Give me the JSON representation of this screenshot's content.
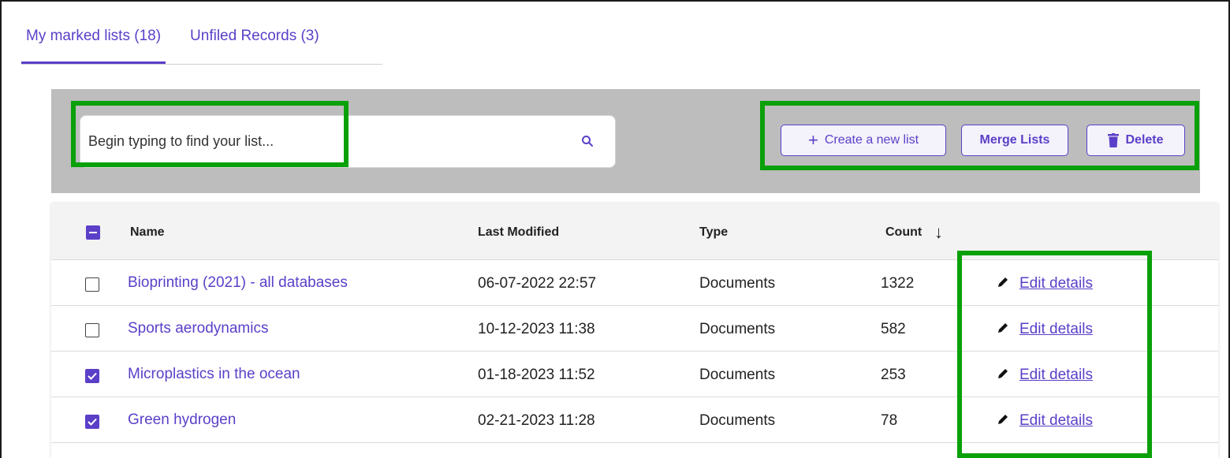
{
  "tabs": [
    {
      "label": "My marked lists (18)",
      "active": true
    },
    {
      "label": "Unfiled Records (3)",
      "active": false
    }
  ],
  "search": {
    "placeholder": "Begin typing to find your list..."
  },
  "actions": {
    "create": "+",
    "create_label": "Create a new list",
    "merge": "Merge Lists",
    "delete": "Delete"
  },
  "table": {
    "headers": {
      "name": "Name",
      "modified": "Last Modified",
      "type": "Type",
      "count": "Count",
      "sort_indicator": "↓"
    },
    "rows": [
      {
        "checked": false,
        "name": "Bioprinting (2021) - all databases",
        "modified": "06-07-2022 22:57",
        "type": "Documents",
        "count": "1322",
        "action": "Edit details"
      },
      {
        "checked": false,
        "name": "Sports aerodynamics",
        "modified": "10-12-2023 11:38",
        "type": "Documents",
        "count": "582",
        "action": "Edit details"
      },
      {
        "checked": true,
        "name": "Microplastics in the ocean",
        "modified": "01-18-2023 11:52",
        "type": "Documents",
        "count": "253",
        "action": "Edit details"
      },
      {
        "checked": true,
        "name": "Green hydrogen",
        "modified": "02-21-2023 11:28",
        "type": "Documents",
        "count": "78",
        "action": "Edit details"
      }
    ]
  },
  "colors": {
    "accent": "#5b3fc8",
    "highlight": "#0aa00a",
    "toolbar_bg": "#bdbdbd"
  },
  "icons": [
    "search-icon",
    "plus-icon",
    "trash-icon",
    "pencil-icon",
    "sort-down-icon",
    "checkbox-icon"
  ]
}
